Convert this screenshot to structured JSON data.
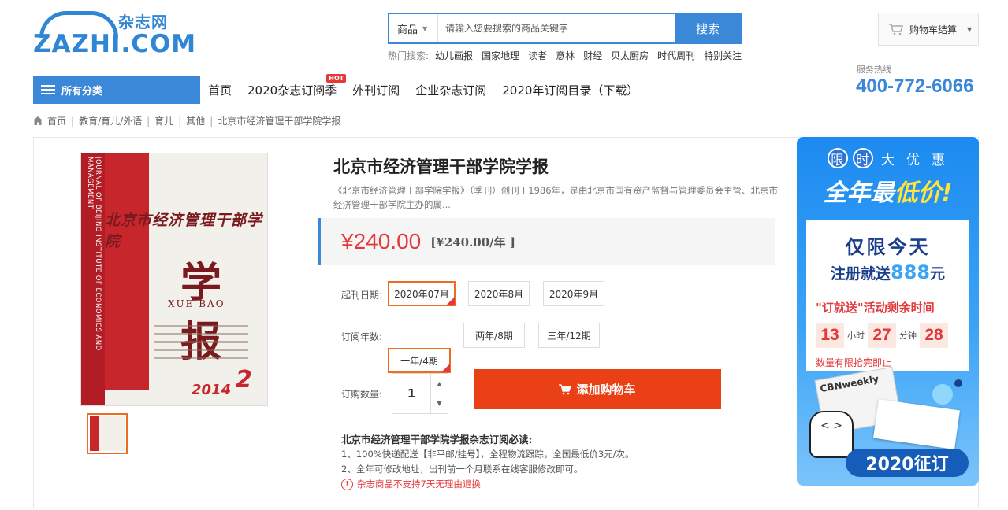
{
  "logo": {
    "cn": "杂志网",
    "en": "ZAZHI.COM"
  },
  "search": {
    "category": "商品",
    "placeholder": "请输入您要搜索的商品关键字",
    "button": "搜索"
  },
  "hot_search": {
    "label": "热门搜索:",
    "items": [
      "幼儿画报",
      "国家地理",
      "读者",
      "意林",
      "财经",
      "贝太厨房",
      "时代周刊",
      "特别关注"
    ]
  },
  "cart": {
    "label": "购物车结算"
  },
  "nav": {
    "all_categories": "所有分类",
    "items": [
      "首页",
      "2020杂志订阅季",
      "外刊订阅",
      "企业杂志订阅",
      "2020年订阅目录（下载）"
    ],
    "hot_badge": "HOT"
  },
  "hotline": {
    "label": "服务热线",
    "number": "400-772-6066"
  },
  "breadcrumb": [
    "首页",
    "教育/育儿/外语",
    "育儿",
    "其他",
    "北京市经济管理干部学院学报"
  ],
  "cover": {
    "vertical_en": "JOURNAL OF BEIJING INSTITUTE OF ECONOMICS AND MANAGEMENT",
    "title_cn": "北京市经济管理干部学院",
    "title_big": "学报",
    "title_pinyin": "XUE BAO",
    "year": "2014",
    "issue": "2"
  },
  "product": {
    "title": "北京市经济管理干部学院学报",
    "description": "《北京市经济管理干部学院学报》（季刊）创刊于1986年，是由北京市国有资产监督与管理委员会主管、北京市经济管理干部学院主办的属...",
    "price": "¥240.00",
    "price_per_year": "[¥240.00/年 ]",
    "start_date_label": "起刊日期:",
    "start_dates": [
      "2020年07月",
      "2020年8月",
      "2020年9月"
    ],
    "years_label": "订阅年数:",
    "years": [
      "一年/4期",
      "两年/8期",
      "三年/12期"
    ],
    "qty_label": "订购数量:",
    "qty": "1",
    "add_cart": "添加购物车"
  },
  "notice": {
    "heading": "北京市经济管理干部学院学报杂志订阅必读:",
    "line1": "1、100%快递配送【非平邮/挂号】，全程物流跟踪，全国最低价3元/次。",
    "line2": "2、全年可修改地址，出刊前一个月联系在线客服修改即可。",
    "warning": "杂志商品不支持7天无理由退换"
  },
  "ad": {
    "top_chars": [
      "限",
      "时",
      "大",
      "优",
      "惠"
    ],
    "big_pre": "全年最",
    "big_em": "低价!",
    "card_line1": "仅限今天",
    "card_line2_pre": "注册就送",
    "card_line2_num": "888",
    "card_line2_post": "元",
    "card_line3": "\"订就送\"活动剩余时间",
    "hours": "13",
    "hours_lbl": "小时",
    "minutes": "27",
    "minutes_lbl": "分钟",
    "seconds": "28",
    "card_line5": "数量有限抢完即止",
    "magazine": "CBNweekly",
    "pill": "2020征订"
  }
}
